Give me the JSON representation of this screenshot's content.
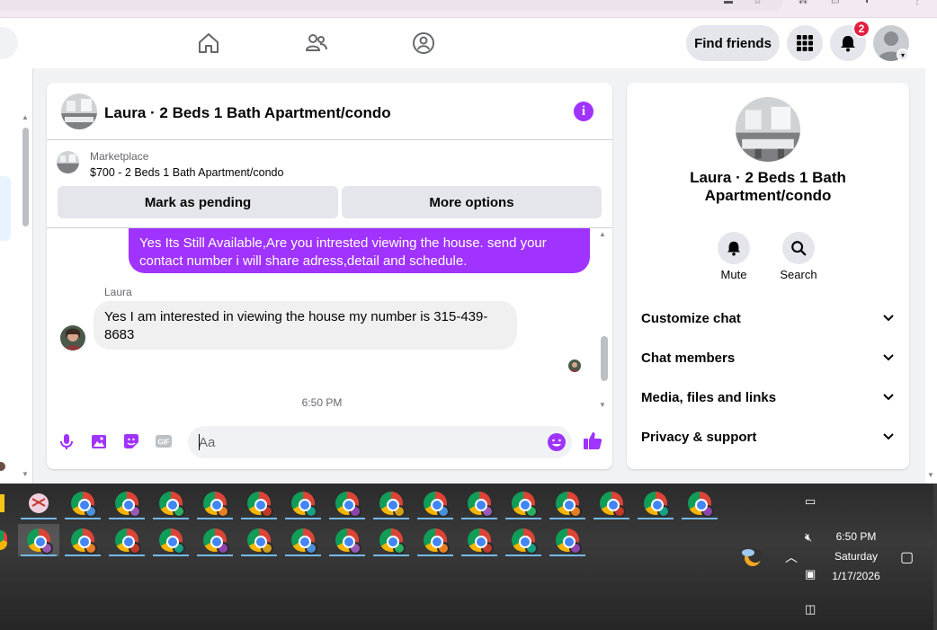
{
  "browser": {
    "url_fragment": "..."
  },
  "header": {
    "find_friends_label": "Find friends",
    "notification_count": "2"
  },
  "chat": {
    "title": "Laura · 2 Beds 1 Bath Apartment/condo",
    "marketplace_label": "Marketplace",
    "listing": "$700 - 2 Beds 1 Bath Apartment/condo",
    "mark_pending_label": "Mark as pending",
    "more_options_label": "More options",
    "outgoing_message": "Yes Its Still Available,Are you intrested viewing the house. send your contact number i will share adress,detail and schedule.",
    "sender_name": "Laura",
    "incoming_message": "Yes I am interested in viewing the house my number is 315-439-8683",
    "timestamp": "6:50 PM",
    "composer_placeholder": "Aa",
    "accent_color": "#a033ff"
  },
  "info_panel": {
    "name": "Laura · 2 Beds 1 Bath Apartment/condo",
    "actions": [
      {
        "label": "Mute",
        "icon": "bell-icon"
      },
      {
        "label": "Search",
        "icon": "search-icon"
      }
    ],
    "rows": [
      {
        "label": "Customize chat"
      },
      {
        "label": "Chat members"
      },
      {
        "label": "Media, files and links"
      },
      {
        "label": "Privacy & support"
      }
    ]
  },
  "taskbar": {
    "time": "6:50 PM",
    "day": "Saturday",
    "date": "1/17/2026"
  }
}
